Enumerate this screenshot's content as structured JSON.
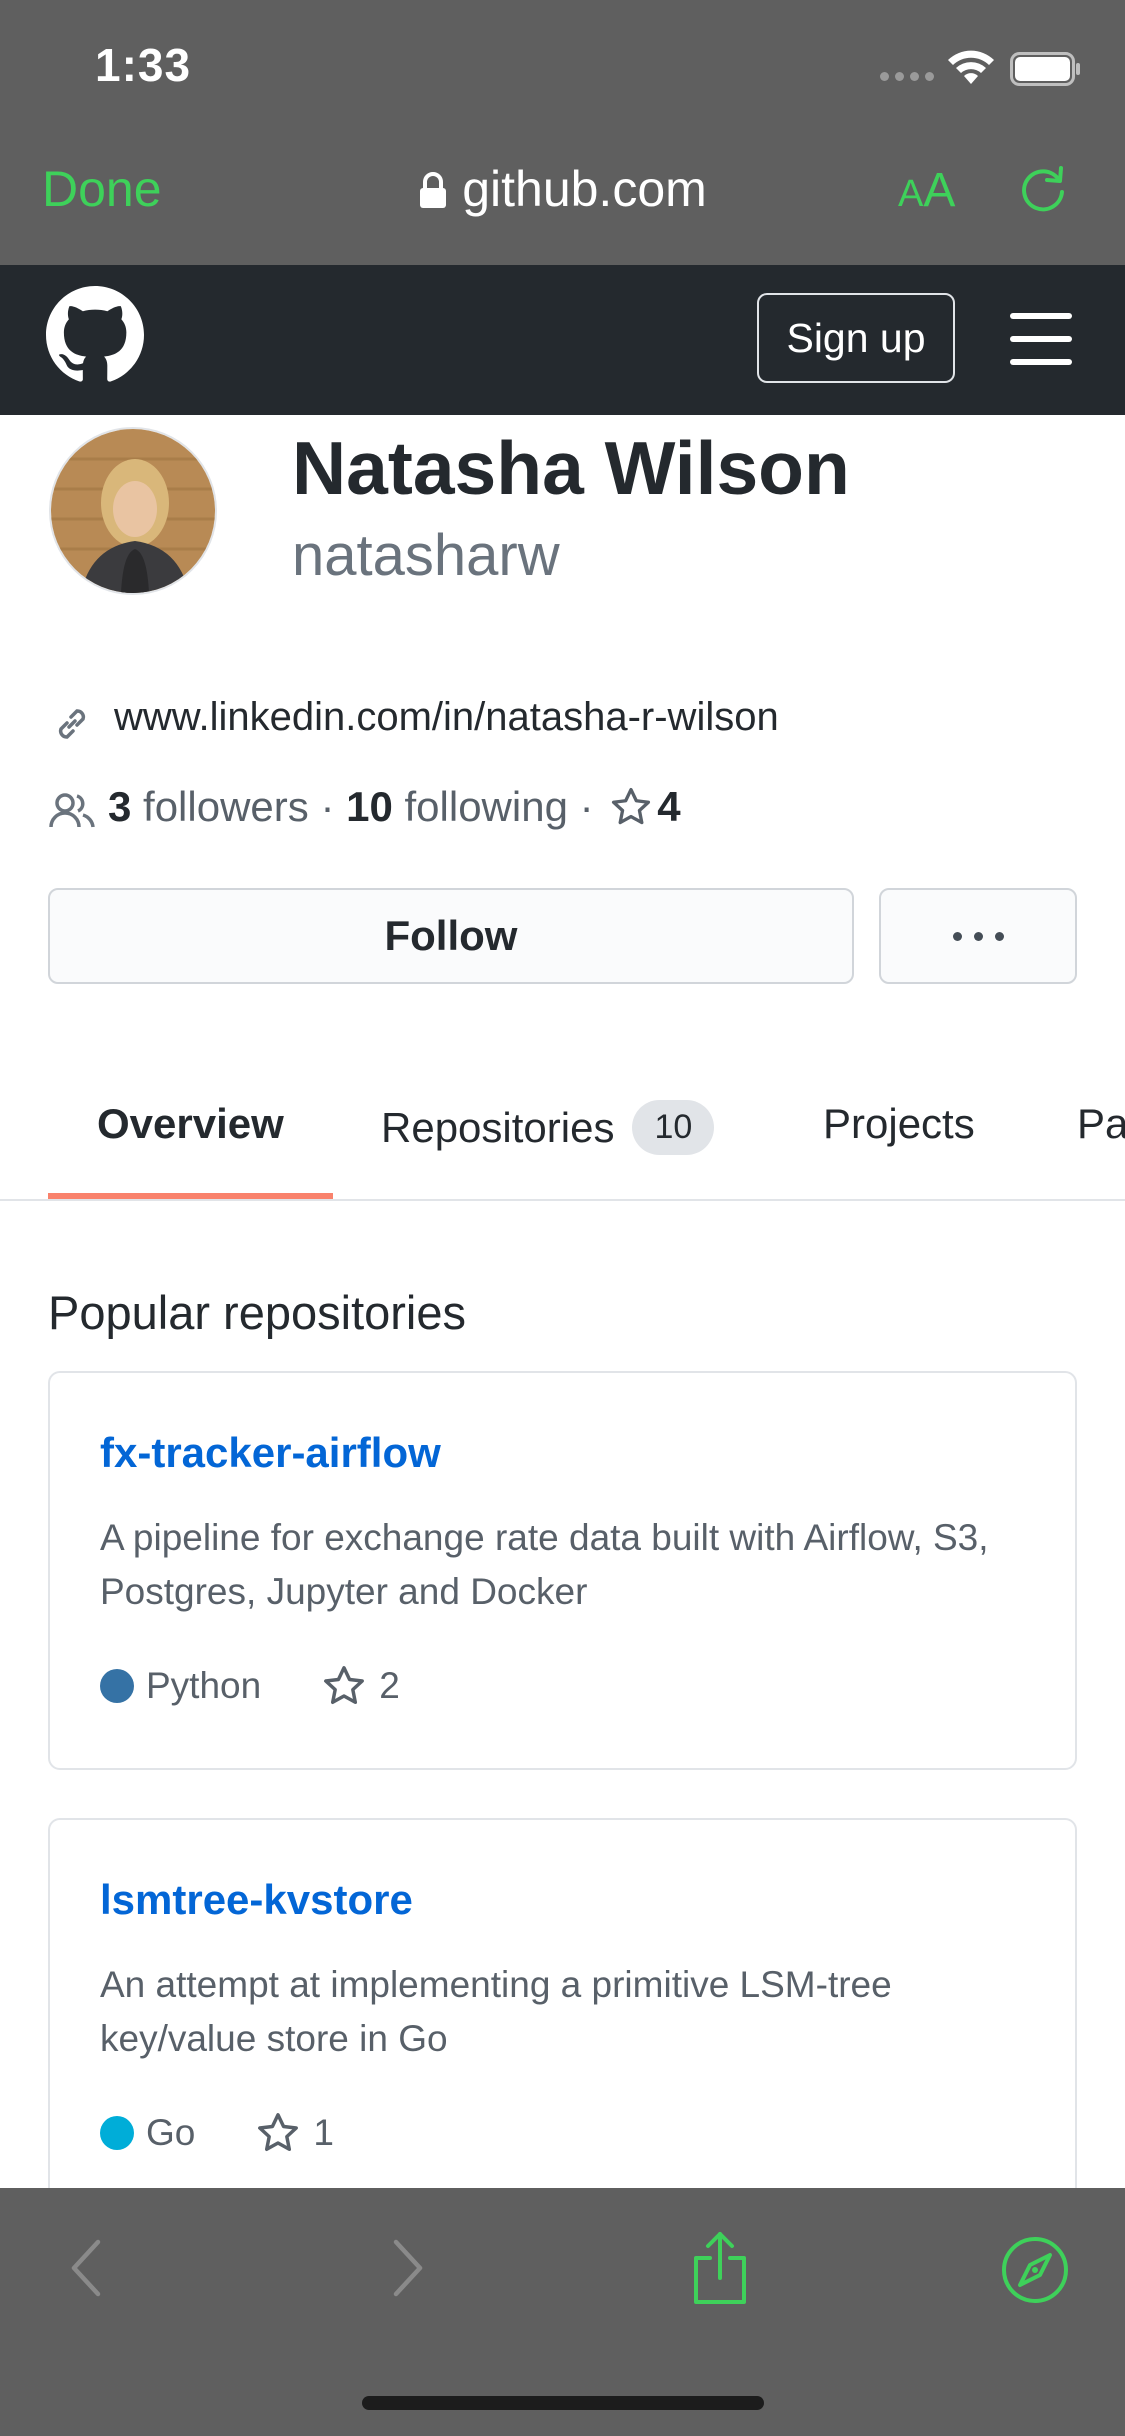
{
  "status": {
    "time": "1:33"
  },
  "browser": {
    "done_label": "Done",
    "url": "github.com",
    "text_size_label_small": "A",
    "text_size_label_big": "A",
    "accent_color": "#3ed15a"
  },
  "github_header": {
    "signup_label": "Sign up"
  },
  "profile": {
    "name": "Natasha Wilson",
    "login": "natasharw",
    "website": "www.linkedin.com/in/natasha-r-wilson",
    "followers_count": "3",
    "followers_label": "followers",
    "separator": "·",
    "following_count": "10",
    "following_label": "following",
    "stars_count": "4",
    "follow_label": "Follow"
  },
  "tabs": {
    "overview": "Overview",
    "repositories": "Repositories",
    "repositories_count": "10",
    "projects": "Projects",
    "packages": "Pa",
    "active_color": "#f9826c"
  },
  "popular": {
    "title": "Popular repositories",
    "repos": [
      {
        "name": "fx-tracker-airflow",
        "description": "A pipeline for exchange rate data built with Airflow, S3, Postgres, Jupyter and Docker",
        "language": "Python",
        "language_color": "#3572A5",
        "stars": "2"
      },
      {
        "name": "lsmtree-kvstore",
        "description": "An attempt at implementing a primitive LSM-tree key/value store in Go",
        "language": "Go",
        "language_color": "#00ADD8",
        "stars": "1"
      }
    ]
  },
  "icons": [
    "lock-icon",
    "reload-icon",
    "github-logo-icon",
    "hamburger-icon",
    "link-icon",
    "people-icon",
    "star-icon",
    "back-icon",
    "forward-icon",
    "share-icon",
    "compass-icon"
  ]
}
